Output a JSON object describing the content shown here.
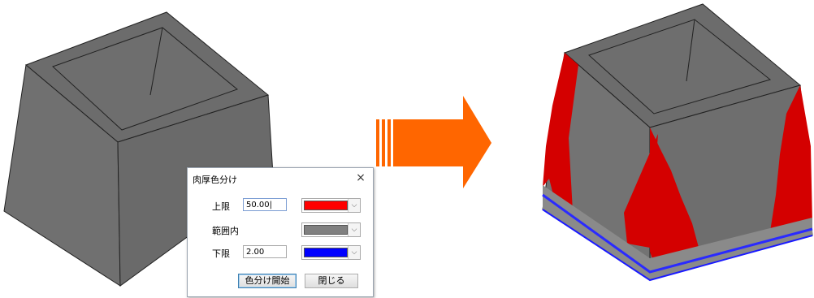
{
  "dialog": {
    "title": "肉厚色分け",
    "close_glyph": "×",
    "upper": {
      "label": "上限",
      "value": "50.00|",
      "color": "#ff0000"
    },
    "range": {
      "label": "範囲内",
      "color": "#808080"
    },
    "lower": {
      "label": "下限",
      "value": "2.00",
      "color": "#0000ff"
    },
    "start_button": "色分け開始",
    "close_button": "閉じる"
  },
  "icons": {
    "dropdown": "chevron-down-icon",
    "close": "close-icon",
    "transform_arrow": "right-arrow-icon"
  },
  "colors": {
    "model_gray": "#6b6b6b",
    "arrow": "#ff6600",
    "thick": "#e00000",
    "thin": "#2a2aff"
  }
}
